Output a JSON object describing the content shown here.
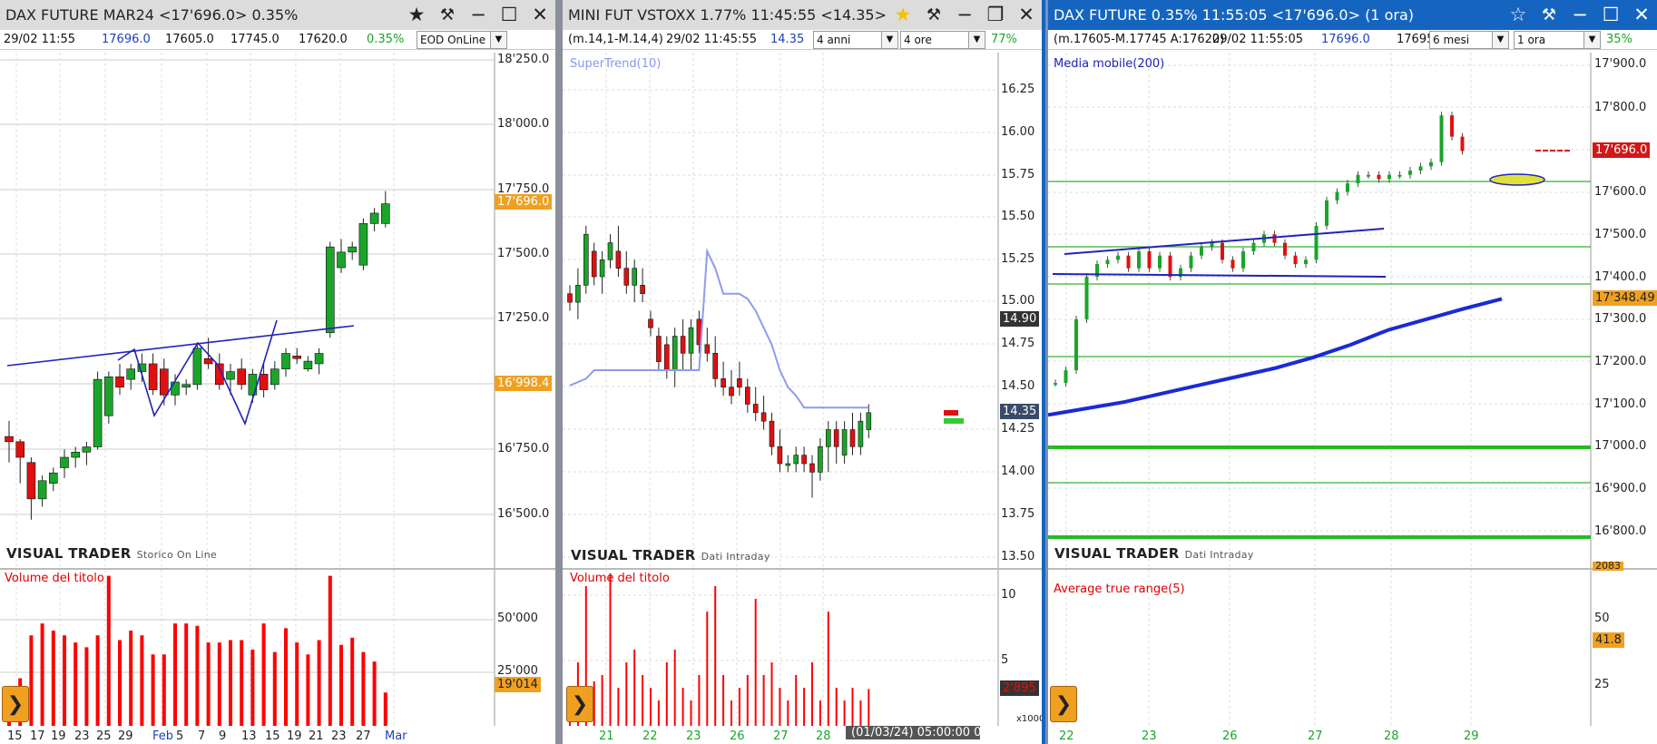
{
  "colors": {
    "up": "#1aa52a",
    "down": "#e01010",
    "trend": "#2222bb",
    "green_line": "#33b233",
    "volume": "#ff0000",
    "grey_title": "#dcdcdc",
    "blue_title": "#1565c0",
    "accent": "#f0a020"
  },
  "left": {
    "title": "DAX FUTURE MAR24 <17'696.0> 0.35%",
    "info": {
      "date": "29/02 11:55",
      "last": "17696.0",
      "open": "17605.0",
      "high": "17745.0",
      "low": "17620.0",
      "chg": "0.35%"
    },
    "source_select": "EOD OnLine",
    "watermark": "VISUAL TRADER",
    "watermark_sub": "Storico On Line",
    "volume_label": "Volume del titolo",
    "y_labels": [
      "18'250.0",
      "18'000.0",
      "17'750.0",
      "17'500.0",
      "17'250.0",
      "16'750.0",
      "16'500.0"
    ],
    "price_tag": "17'696.0",
    "level_tag": "16'998.4",
    "vol_labels": [
      "50'000",
      "25'000"
    ],
    "vol_tag": "19'014",
    "x_labels": [
      "15",
      "17",
      "19",
      "23",
      "25",
      "29",
      "Feb",
      "5",
      "7",
      "9",
      "13",
      "15",
      "19",
      "21",
      "23",
      "27",
      "Mar"
    ]
  },
  "middle": {
    "title": "MINI FUT VSTOXX 1.77% 11:45:55 <14.35>",
    "info": {
      "params": "(m.14,1-M.14,4)",
      "datetime": "29/02 11:45:55",
      "last": "14.35"
    },
    "range_select": "4 anni",
    "period_select": "4 ore",
    "pct": "77%",
    "indicator": "SuperTrend(10)",
    "watermark": "VISUAL TRADER",
    "watermark_sub": "Dati Intraday",
    "volume_label": "Volume del titolo",
    "y_labels": [
      "16.25",
      "16.00",
      "15.75",
      "15.50",
      "15.25",
      "15.00",
      "14.75",
      "14.50",
      "14.25",
      "14.00",
      "13.75",
      "13.50"
    ],
    "tag_a": "14.90",
    "price_tag": "14.35",
    "vol_labels": [
      "10",
      "5"
    ],
    "vol_tag": "2'895",
    "vol_mult": "x1000",
    "x_labels": [
      "21",
      "22",
      "23",
      "26",
      "27",
      "28"
    ],
    "cursor_tip": "(01/03/24) 05:00:00 0"
  },
  "right": {
    "title": "DAX FUTURE 0.35% 11:55:05 <17'696.0> (1 ora)",
    "info": {
      "params": "(m.17605-M.17745 A:17620)",
      "datetime": "29/02 11:55:05",
      "last": "17696.0",
      "last2": "17695"
    },
    "range_select": "6 mesi",
    "period_select": "1 ora",
    "pct": "35%",
    "indicator": "Media mobile(200)",
    "watermark": "VISUAL TRADER",
    "watermark_sub": "Dati Intraday",
    "atr_label": "Average true range(5)",
    "y_labels": [
      "17'900.0",
      "17'800.0",
      "17'700.0",
      "17'600.0",
      "17'500.0",
      "17'400.0",
      "17'300.0",
      "17'200.0",
      "17'100.0",
      "17'000.0",
      "16'900.0",
      "16'800.0"
    ],
    "price_tag": "17'696.0",
    "ma_tag": "17'348.49",
    "atr_top_tag": "2083",
    "atr_labels": [
      "50",
      "25"
    ],
    "atr_tag": "41.8",
    "x_labels": [
      "22",
      "23",
      "26",
      "27",
      "28",
      "29"
    ]
  },
  "chart_data": [
    {
      "type": "candlestick",
      "title": "DAX FUTURE MAR24",
      "y_range": [
        16350,
        18300
      ],
      "candles": [
        [
          16800,
          16860,
          16700,
          16780
        ],
        [
          16780,
          16790,
          16620,
          16720
        ],
        [
          16700,
          16720,
          16480,
          16560
        ],
        [
          16560,
          16650,
          16530,
          16630
        ],
        [
          16620,
          16680,
          16590,
          16660
        ],
        [
          16680,
          16750,
          16640,
          16720
        ],
        [
          16720,
          16760,
          16680,
          16740
        ],
        [
          16740,
          16780,
          16690,
          16760
        ],
        [
          16760,
          17050,
          16750,
          17020
        ],
        [
          16880,
          17050,
          16850,
          17030
        ],
        [
          17030,
          17080,
          16960,
          16990
        ],
        [
          17020,
          17080,
          16980,
          17060
        ],
        [
          17050,
          17120,
          17010,
          17080
        ],
        [
          17080,
          17120,
          16960,
          16980
        ],
        [
          17060,
          17100,
          16920,
          16960
        ],
        [
          16960,
          17040,
          16920,
          17010
        ],
        [
          16990,
          17020,
          16960,
          17000
        ],
        [
          17000,
          17160,
          16980,
          17140
        ],
        [
          17100,
          17180,
          17060,
          17080
        ],
        [
          17080,
          17120,
          16980,
          17000
        ],
        [
          17020,
          17080,
          16960,
          17050
        ],
        [
          17060,
          17100,
          16980,
          17000
        ],
        [
          16960,
          17060,
          16930,
          17040
        ],
        [
          17040,
          17080,
          16950,
          16980
        ],
        [
          17000,
          17090,
          16980,
          17060
        ],
        [
          17060,
          17140,
          17030,
          17120
        ],
        [
          17110,
          17140,
          17080,
          17100
        ],
        [
          17060,
          17110,
          17050,
          17090
        ],
        [
          17080,
          17140,
          17040,
          17120
        ],
        [
          17200,
          17550,
          17180,
          17530
        ],
        [
          17450,
          17560,
          17430,
          17510
        ],
        [
          17510,
          17550,
          17480,
          17530
        ],
        [
          17460,
          17640,
          17440,
          17620
        ],
        [
          17620,
          17680,
          17590,
          17660
        ],
        [
          17620,
          17745,
          17605,
          17696
        ]
      ],
      "volume": [
        16000,
        20000,
        38000,
        43000,
        40000,
        38000,
        35000,
        33000,
        38000,
        63000,
        36000,
        40000,
        38000,
        30000,
        30000,
        43000,
        43000,
        42000,
        35000,
        35000,
        36000,
        36000,
        32000,
        43000,
        31000,
        41000,
        35000,
        30000,
        36000,
        63000,
        34000,
        37000,
        31000,
        27000,
        14000
      ]
    },
    {
      "type": "candlestick",
      "title": "MINI FUT VSTOXX",
      "y_range": [
        13.45,
        16.45
      ],
      "candles": [
        [
          15.05,
          15.1,
          14.95,
          15.0
        ],
        [
          15.0,
          15.2,
          14.9,
          15.1
        ],
        [
          15.1,
          15.45,
          15.05,
          15.4
        ],
        [
          15.3,
          15.35,
          15.1,
          15.15
        ],
        [
          15.15,
          15.3,
          15.05,
          15.25
        ],
        [
          15.25,
          15.4,
          15.2,
          15.35
        ],
        [
          15.3,
          15.45,
          15.15,
          15.2
        ],
        [
          15.2,
          15.3,
          15.05,
          15.1
        ],
        [
          15.1,
          15.25,
          15.0,
          15.2
        ],
        [
          15.1,
          15.2,
          15.0,
          15.05
        ],
        [
          14.9,
          14.95,
          14.8,
          14.85
        ],
        [
          14.8,
          14.85,
          14.6,
          14.65
        ],
        [
          14.75,
          14.8,
          14.55,
          14.6
        ],
        [
          14.6,
          14.85,
          14.5,
          14.8
        ],
        [
          14.8,
          14.9,
          14.6,
          14.7
        ],
        [
          14.7,
          14.9,
          14.6,
          14.85
        ],
        [
          14.9,
          14.95,
          14.7,
          14.75
        ],
        [
          14.75,
          14.85,
          14.65,
          14.7
        ],
        [
          14.7,
          14.8,
          14.5,
          14.55
        ],
        [
          14.55,
          14.65,
          14.45,
          14.5
        ],
        [
          14.5,
          14.6,
          14.4,
          14.45
        ],
        [
          14.55,
          14.65,
          14.45,
          14.5
        ],
        [
          14.5,
          14.55,
          14.35,
          14.4
        ],
        [
          14.4,
          14.5,
          14.3,
          14.35
        ],
        [
          14.35,
          14.45,
          14.25,
          14.3
        ],
        [
          14.3,
          14.35,
          14.1,
          14.15
        ],
        [
          14.15,
          14.25,
          14.0,
          14.05
        ],
        [
          14.05,
          14.1,
          14.0,
          14.05
        ],
        [
          14.05,
          14.15,
          14.0,
          14.1
        ],
        [
          14.1,
          14.15,
          14.0,
          14.05
        ],
        [
          14.05,
          14.1,
          13.85,
          14.0
        ],
        [
          14.0,
          14.2,
          13.95,
          14.15
        ],
        [
          14.15,
          14.3,
          14.0,
          14.25
        ],
        [
          14.25,
          14.3,
          14.05,
          14.15
        ],
        [
          14.1,
          14.3,
          14.05,
          14.25
        ],
        [
          14.25,
          14.35,
          14.1,
          14.15
        ],
        [
          14.15,
          14.35,
          14.1,
          14.3
        ],
        [
          14.25,
          14.4,
          14.2,
          14.35
        ]
      ],
      "supertrend": [
        14.51,
        14.53,
        14.55,
        14.6,
        14.6,
        14.6,
        14.6,
        14.6,
        14.6,
        14.6,
        14.6,
        14.6,
        14.6,
        14.6,
        14.6,
        14.6,
        14.6,
        15.3,
        15.2,
        15.05,
        15.05,
        15.05,
        15.02,
        14.95,
        14.85,
        14.75,
        14.6,
        14.5,
        14.45,
        14.38,
        14.38,
        14.38,
        14.38,
        14.38,
        14.38,
        14.38,
        14.38,
        14.38
      ],
      "volume": [
        3000,
        5000,
        11000,
        3500,
        4000,
        12000,
        3000,
        5000,
        6000,
        4000,
        3000,
        2000,
        5000,
        6000,
        3000,
        2000,
        4000,
        9000,
        11000,
        4000,
        2000,
        3000,
        4000,
        10000,
        4000,
        5000,
        3000,
        2000,
        4000,
        3000,
        5000,
        2000,
        9000,
        3000,
        2000,
        3000,
        2000,
        2895
      ]
    },
    {
      "type": "line",
      "title": "DAX FUTURE (1 ora)",
      "y_range": [
        16775,
        17925
      ],
      "series": [
        {
          "name": "Media mobile(200)",
          "values": [
            17075,
            17090,
            17105,
            17125,
            17145,
            17165,
            17185,
            17210,
            17240,
            17275,
            17300,
            17325,
            17348
          ]
        }
      ],
      "close": [
        17150,
        17180,
        17300,
        17400,
        17430,
        17440,
        17450,
        17420,
        17460,
        17420,
        17450,
        17400,
        17420,
        17450,
        17470,
        17480,
        17440,
        17420,
        17460,
        17480,
        17500,
        17480,
        17450,
        17430,
        17440,
        17520,
        17580,
        17600,
        17620,
        17640,
        17640,
        17630,
        17640,
        17640,
        17650,
        17660,
        17670,
        17780,
        17730,
        17696
      ]
    }
  ]
}
